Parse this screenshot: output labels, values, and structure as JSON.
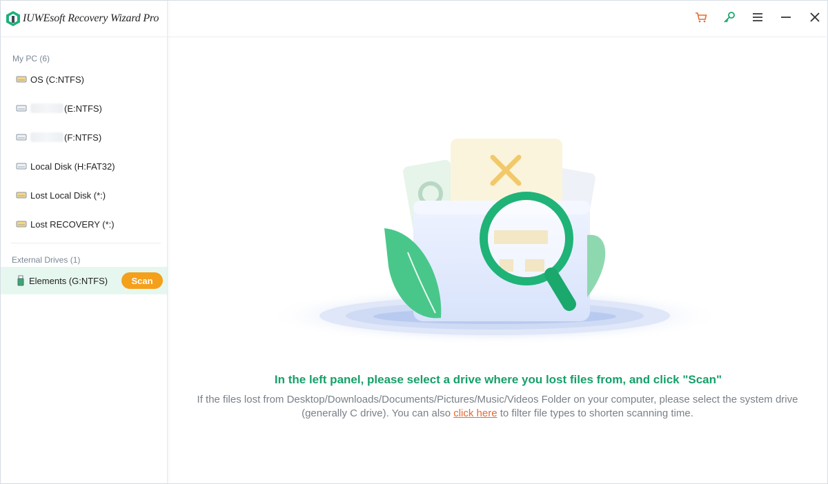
{
  "app": {
    "title": "IUWEsoft Recovery Wizard Pro"
  },
  "toolbar": {
    "icons": [
      "cart-icon",
      "key-icon",
      "menu-icon",
      "minimize-icon",
      "close-icon"
    ]
  },
  "sidebar": {
    "my_pc_label": "My PC (6)",
    "drives": [
      {
        "label": "OS (C:NTFS)"
      },
      {
        "label": "(E:NTFS)"
      },
      {
        "label": "(F:NTFS)"
      },
      {
        "label": "Local Disk (H:FAT32)"
      },
      {
        "label": "Lost Local Disk (*:)"
      },
      {
        "label": "Lost RECOVERY (*:)"
      }
    ],
    "external_label": "External Drives (1)",
    "external": [
      {
        "label": "Elements (G:NTFS)",
        "scan_label": "Scan"
      }
    ]
  },
  "main": {
    "headline": "In the left panel, please select a drive where you lost files from, and click \"Scan\"",
    "desc_before": "If the files lost from Desktop/Downloads/Documents/Pictures/Music/Videos Folder on your computer, please select the system drive (generally C drive). You can also ",
    "link_text": "click here",
    "desc_after": " to filter file types to shorten scanning time."
  },
  "colors": {
    "accent": "#16a06a",
    "scan": "#f5a01a",
    "link": "#e8692f",
    "selected_bg": "#e6f7ef"
  }
}
